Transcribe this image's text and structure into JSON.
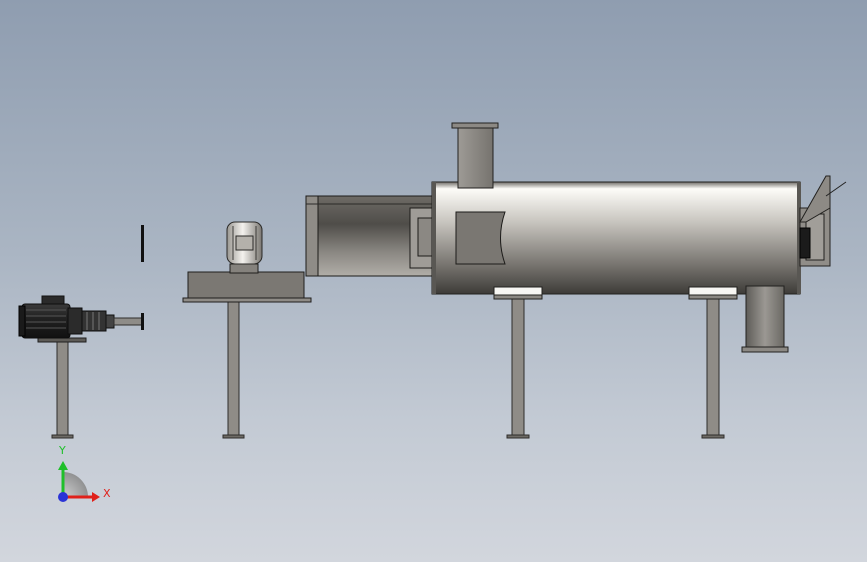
{
  "app": {
    "view": "cad-3d-viewport"
  },
  "triad": {
    "x_label": "X",
    "y_label": "Y",
    "x_color": "#e0201a",
    "y_color": "#1fbf2a",
    "z_color": "#2a33d6"
  },
  "colors": {
    "background_top": "#8f9db0",
    "background_bottom": "#d2d6dd",
    "steel_dark": "#55524d",
    "steel_mid": "#8c8a85",
    "steel_light": "#f2f0ec"
  }
}
